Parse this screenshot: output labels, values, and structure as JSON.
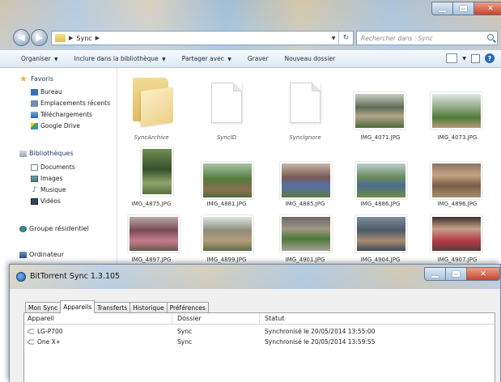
{
  "explorer": {
    "search_placeholder": "Rechercher dans : Sync",
    "breadcrumb": [
      "Sync"
    ],
    "toolbar": {
      "organize": "Organiser",
      "include_library": "Inclure dans la bibliothèque",
      "share": "Partager avec",
      "burn": "Graver",
      "new_folder": "Nouveau dossier"
    },
    "nav": {
      "favorites_header": "Favoris",
      "favorites": [
        "Bureau",
        "Emplacements récents",
        "Téléchargements",
        "Google Drive"
      ],
      "libraries_header": "Bibliothèques",
      "libraries": [
        "Documents",
        "Images",
        "Musique",
        "Vidéos"
      ],
      "homegroup": "Groupe résidentiel",
      "computer": "Ordinateur"
    },
    "items": [
      {
        "name": "SyncArchive",
        "kind": "folder"
      },
      {
        "name": "SyncID",
        "kind": "file"
      },
      {
        "name": "SyncIgnore",
        "kind": "file"
      },
      {
        "name": "IMG_4071.JPG",
        "kind": "photo"
      },
      {
        "name": "IMG_4073.JPG",
        "kind": "photo"
      },
      {
        "name": "IMG_4875.JPG",
        "kind": "photo"
      },
      {
        "name": "IMG_4881.JPG",
        "kind": "photo"
      },
      {
        "name": "IMG_4885.JPG",
        "kind": "photo"
      },
      {
        "name": "IMG_4886.JPG",
        "kind": "photo"
      },
      {
        "name": "IMG_4896.JPG",
        "kind": "photo"
      },
      {
        "name": "IMG_4897.JPG",
        "kind": "photo"
      },
      {
        "name": "IMG_4899.JPG",
        "kind": "photo"
      },
      {
        "name": "IMG_4901.JPG",
        "kind": "photo"
      },
      {
        "name": "IMG_4904.JPG",
        "kind": "photo"
      },
      {
        "name": "IMG_4907.JPG",
        "kind": "photo"
      }
    ]
  },
  "bts": {
    "title": "BitTorrent Sync 1.3.105",
    "tabs": [
      "Mon Sync",
      "Appareils",
      "Transferts",
      "Historique",
      "Préférences"
    ],
    "active_tab": "Appareils",
    "columns": [
      "Appareil",
      "Dossier",
      "Statut"
    ],
    "rows": [
      {
        "device": "LG-P700",
        "folder": "Sync",
        "status": "Synchronisé le 20/05/2014 13:55:00"
      },
      {
        "device": "One X+",
        "folder": "Sync",
        "status": "Synchronisé le 20/05/2014 13:59:55"
      }
    ]
  },
  "colors": {
    "folder_yellow": "#e6c266",
    "nav_link": "#1f3a64",
    "close_red": "#c7432a",
    "bts_blue": "#1b58a8"
  }
}
